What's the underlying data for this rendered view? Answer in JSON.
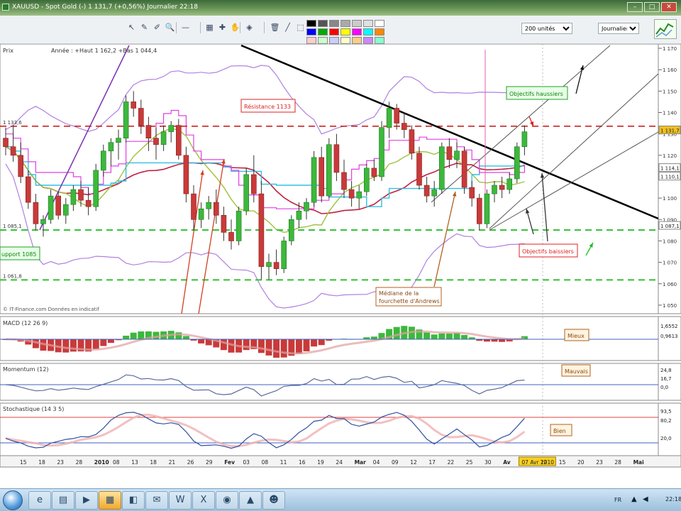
{
  "window": {
    "title": "XAUUSD - Spot Gold (-)    1 131,7 (+0,56%)    Journalier  22:18",
    "minimize": "–",
    "maximize": "□",
    "close": "✕"
  },
  "toolbar": {
    "tools": [
      "cursor-icon",
      "pencil-icon",
      "pen-icon",
      "zoom-icon",
      "hline-icon",
      "print-icon",
      "crosshair-icon",
      "hand-icon",
      "fill-icon",
      "trash-icon",
      "line-icon",
      "select-icon"
    ],
    "tool_glyphs": [
      "↖",
      "✎",
      "✐",
      "🔍",
      "—",
      "▦",
      "✚",
      "✋",
      "◈",
      "🗑",
      "╱",
      "⬚"
    ],
    "palette_colors": [
      "#000000",
      "#555555",
      "#888888",
      "#aaaaaa",
      "#cccccc",
      "#e0e0e0",
      "#ffffff",
      "#0000ff",
      "#00aa00",
      "#ff0000",
      "#ffff00",
      "#ff00ff",
      "#00ffff",
      "#ff8800",
      "#ffcccc",
      "#ccffcc",
      "#ccccff",
      "#ffffcc",
      "#ffcc88",
      "#cc88ff",
      "#88ffcc"
    ],
    "units_select": "200 unités",
    "period_select": "Journalier",
    "corner_icon": "chart-thumbnail-icon"
  },
  "price_panel": {
    "header": "Prix",
    "info": "Année : +Haut 1 162,2 +Bas 1 044,4",
    "watermark": "© IT-Finance.com  Données en indicatif",
    "annotations": {
      "resistance": "Résistance 1133",
      "objectifs_haussiers": "Objectifs haussiers",
      "objectifs_baissiers": "Objectifs baissiers",
      "support": "upport 1085",
      "mediane_1": "Médiane de la",
      "mediane_2": "fourchette d'Andrews"
    },
    "level_labels": [
      "1 133,6",
      "1 085,1",
      "1 061,8"
    ],
    "right_tags": [
      "1 131,7",
      "1 114,1",
      "1 110,1",
      "1 087,1"
    ]
  },
  "macd_panel": {
    "header": "MACD (12 26 9)",
    "annotation": "Mieux",
    "right_tags": [
      "1,6552",
      "0,9613"
    ]
  },
  "momentum_panel": {
    "header": "Momentum (12)",
    "annotation": "Mauvais",
    "right_tags": [
      "24,8",
      "16,7",
      "0,0"
    ]
  },
  "stoch_panel": {
    "header": "Stochastique (14 3 5)",
    "annotation": "Bien",
    "right_tags": [
      "93,5",
      "80,2",
      "20,0"
    ]
  },
  "x_axis": {
    "labels": [
      "15",
      "18",
      "23",
      "28",
      "2010",
      "08",
      "13",
      "18",
      "21",
      "26",
      "29",
      "Fev",
      "03",
      "08",
      "11",
      "16",
      "19",
      "24",
      "Mar",
      "04",
      "09",
      "12",
      "17",
      "22",
      "25",
      "30",
      "Av",
      "07 Avr 2010",
      "12",
      "15",
      "20",
      "23",
      "28",
      "Mai"
    ],
    "bold": [
      "2010",
      "Fev",
      "Mar",
      "Av",
      "Mai"
    ]
  },
  "taskbar": {
    "apps": [
      "ie-icon",
      "folder-icon",
      "media-icon",
      "chart-app-icon",
      "explorer-icon",
      "mail-icon",
      "word-icon",
      "excel-icon",
      "player-icon",
      "vlc-icon",
      "messenger-icon"
    ],
    "app_glyphs": [
      "e",
      "▤",
      "▶",
      "▦",
      "◧",
      "✉",
      "W",
      "X",
      "◉",
      "▲",
      "☻"
    ],
    "clock": "22:18",
    "lang": "FR"
  },
  "chart_data": {
    "type": "candlestick",
    "instrument": "XAUUSD - Spot Gold",
    "period": "Journalier",
    "y_axis_ticks": [
      1170,
      1160,
      1150,
      1140,
      1130,
      1120,
      1110,
      1100,
      1090,
      1080,
      1070,
      1060,
      1050
    ],
    "ylim": [
      1046,
      1172
    ],
    "last_price": 1131.7,
    "change_pct": "+0,56%",
    "year_high": 1162.2,
    "year_low": 1044.4,
    "levels": {
      "resistance": 1133.6,
      "support": 1085.1,
      "support2": 1061.8
    },
    "candles": [
      [
        1128,
        1133,
        1120,
        1124
      ],
      [
        1124,
        1134,
        1117,
        1120
      ],
      [
        1120,
        1126,
        1107,
        1110
      ],
      [
        1110,
        1113,
        1095,
        1098
      ],
      [
        1098,
        1102,
        1085,
        1088
      ],
      [
        1088,
        1092,
        1082,
        1090
      ],
      [
        1090,
        1104,
        1088,
        1101
      ],
      [
        1101,
        1103,
        1090,
        1092
      ],
      [
        1092,
        1100,
        1088,
        1097
      ],
      [
        1097,
        1106,
        1094,
        1104
      ],
      [
        1104,
        1108,
        1096,
        1099
      ],
      [
        1099,
        1105,
        1092,
        1096
      ],
      [
        1096,
        1116,
        1094,
        1113
      ],
      [
        1113,
        1125,
        1110,
        1122
      ],
      [
        1122,
        1128,
        1115,
        1126
      ],
      [
        1126,
        1132,
        1118,
        1128
      ],
      [
        1128,
        1148,
        1126,
        1145
      ],
      [
        1145,
        1150,
        1138,
        1142
      ],
      [
        1142,
        1146,
        1130,
        1134
      ],
      [
        1134,
        1138,
        1122,
        1128
      ],
      [
        1128,
        1133,
        1118,
        1125
      ],
      [
        1125,
        1134,
        1122,
        1131
      ],
      [
        1131,
        1136,
        1126,
        1134
      ],
      [
        1134,
        1137,
        1118,
        1120
      ],
      [
        1120,
        1124,
        1098,
        1102
      ],
      [
        1102,
        1106,
        1085,
        1090
      ],
      [
        1090,
        1098,
        1086,
        1095
      ],
      [
        1095,
        1101,
        1090,
        1098
      ],
      [
        1098,
        1104,
        1088,
        1092
      ],
      [
        1092,
        1096,
        1080,
        1084
      ],
      [
        1084,
        1090,
        1076,
        1080
      ],
      [
        1080,
        1096,
        1078,
        1094
      ],
      [
        1094,
        1114,
        1092,
        1111
      ],
      [
        1111,
        1120,
        1098,
        1102
      ],
      [
        1102,
        1108,
        1062,
        1068
      ],
      [
        1068,
        1074,
        1062,
        1070
      ],
      [
        1070,
        1076,
        1064,
        1067
      ],
      [
        1067,
        1082,
        1065,
        1080
      ],
      [
        1080,
        1092,
        1078,
        1090
      ],
      [
        1090,
        1098,
        1086,
        1094
      ],
      [
        1094,
        1100,
        1090,
        1098
      ],
      [
        1098,
        1122,
        1096,
        1119
      ],
      [
        1119,
        1124,
        1098,
        1101
      ],
      [
        1101,
        1128,
        1100,
        1125
      ],
      [
        1125,
        1130,
        1108,
        1112
      ],
      [
        1112,
        1118,
        1100,
        1104
      ],
      [
        1104,
        1108,
        1096,
        1100
      ],
      [
        1100,
        1106,
        1095,
        1103
      ],
      [
        1103,
        1116,
        1101,
        1114
      ],
      [
        1114,
        1118,
        1108,
        1110
      ],
      [
        1110,
        1136,
        1108,
        1133
      ],
      [
        1133,
        1145,
        1128,
        1142
      ],
      [
        1142,
        1144,
        1132,
        1135
      ],
      [
        1135,
        1140,
        1128,
        1132
      ],
      [
        1132,
        1134,
        1118,
        1121
      ],
      [
        1121,
        1124,
        1104,
        1106
      ],
      [
        1106,
        1110,
        1098,
        1101
      ],
      [
        1101,
        1108,
        1096,
        1104
      ],
      [
        1104,
        1126,
        1102,
        1124
      ],
      [
        1124,
        1128,
        1114,
        1118
      ],
      [
        1118,
        1126,
        1114,
        1122
      ],
      [
        1122,
        1124,
        1102,
        1105
      ],
      [
        1105,
        1108,
        1096,
        1100
      ],
      [
        1100,
        1102,
        1085,
        1088
      ],
      [
        1088,
        1104,
        1086,
        1102
      ],
      [
        1102,
        1108,
        1098,
        1106
      ],
      [
        1106,
        1110,
        1100,
        1104
      ],
      [
        1104,
        1112,
        1102,
        1109
      ],
      [
        1109,
        1126,
        1107,
        1124
      ],
      [
        1124,
        1134,
        1120,
        1131
      ]
    ],
    "indicators": [
      "Moyenne mobile",
      "Bandes de Bollinger",
      "Kijun",
      "Fourchette d'Andrews"
    ],
    "subpanels": [
      {
        "name": "MACD (12 26 9)",
        "type": "histogram+lines"
      },
      {
        "name": "Momentum (12)",
        "type": "line"
      },
      {
        "name": "Stochastique (14 3 5)",
        "type": "lines"
      }
    ]
  }
}
